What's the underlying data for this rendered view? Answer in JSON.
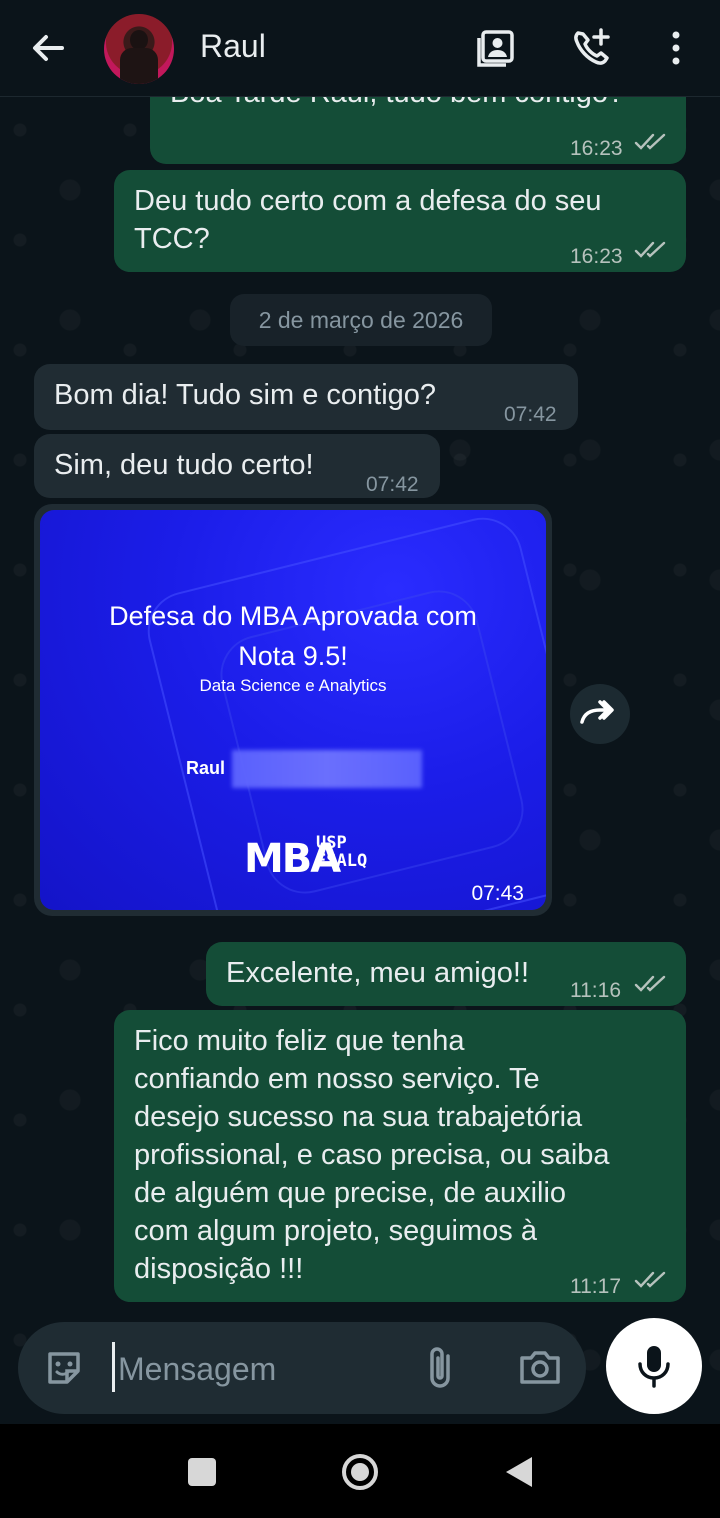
{
  "header": {
    "contact_name": "Raul"
  },
  "messages": {
    "partial_top": {
      "text": "Boa Tarde Raul, tudo bem contigo?",
      "time": "16:23"
    },
    "m1": {
      "text": "Deu tudo certo com a defesa do seu\nTCC?",
      "time": "16:23"
    },
    "date_separator": "2 de março de 2026",
    "m2": {
      "text": "Bom dia! Tudo sim e contigo?",
      "time": "07:42"
    },
    "m3": {
      "text": "Sim, deu tudo certo!",
      "time": "07:42"
    },
    "image": {
      "title_line1": "Defesa do MBA Aprovada com",
      "title_line2": "Nota 9.5!",
      "subtitle": "Data Science e Analytics",
      "name": "Raul",
      "logo_main": "MBA",
      "logo_top": "USP",
      "logo_bottom": "ESALQ",
      "time": "07:43"
    },
    "m4": {
      "text": "Excelente, meu amigo!!",
      "time": "11:16"
    },
    "m5": {
      "text": "Fico muito feliz que tenha\nconfiando em nosso serviço. Te\ndesejo sucesso na sua trabajetória\nprofissional, e caso precisa, ou saiba\nde alguém que precise, de auxilio\ncom algum projeto, seguimos à\ndisposição !!!",
      "time": "11:17"
    }
  },
  "input": {
    "placeholder": "Mensagem"
  },
  "colors": {
    "outgoing_bubble": "#144d37",
    "incoming_bubble": "#202c33",
    "background": "#0b141a",
    "read_ticks": "#b6c2bd"
  },
  "icons": {
    "back": "arrow-left-icon",
    "contact_card": "contact-card-icon",
    "add_call": "phone-plus-icon",
    "menu": "more-vertical-icon",
    "forward": "forward-icon",
    "sticker": "sticker-icon",
    "attach": "paperclip-icon",
    "camera": "camera-icon",
    "mic": "mic-icon"
  }
}
